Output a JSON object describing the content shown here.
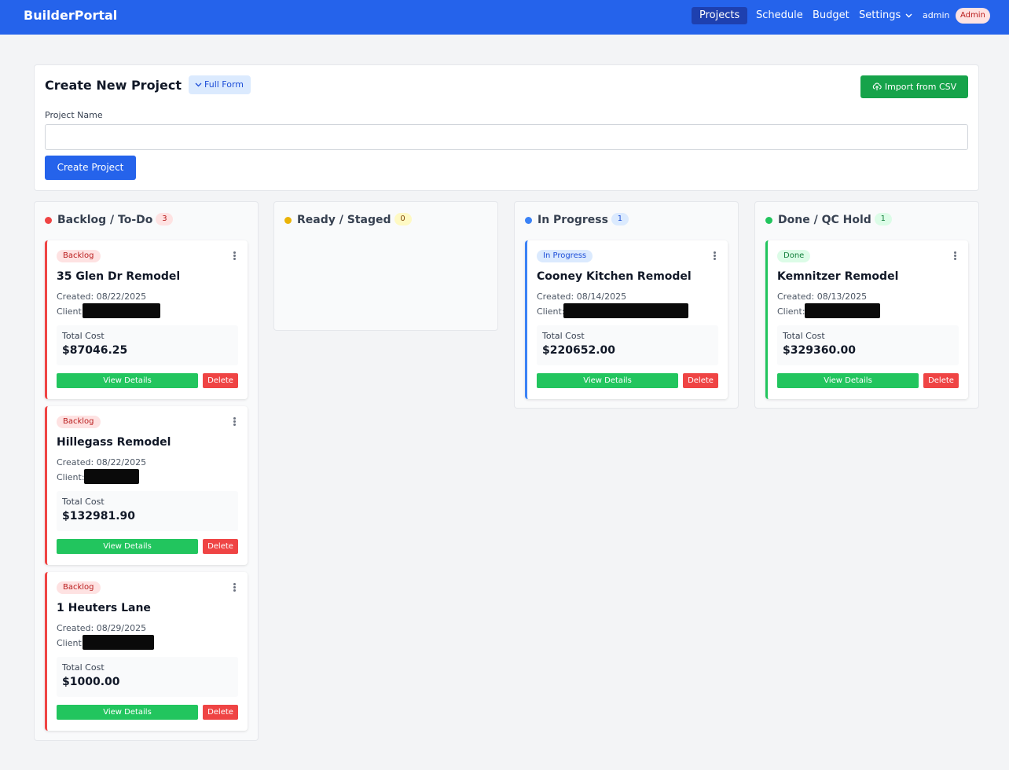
{
  "nav": {
    "brand": "BuilderPortal",
    "items": [
      {
        "label": "Projects",
        "active": true
      },
      {
        "label": "Schedule"
      },
      {
        "label": "Budget"
      },
      {
        "label": "Settings",
        "icon": "chevron-down-icon"
      }
    ],
    "user": "admin",
    "role_badge": "Admin"
  },
  "create_form": {
    "title": "Create New Project",
    "full_form_label": "Full Form",
    "import_label": "Import from CSV",
    "project_name_label": "Project Name",
    "project_name_value": "",
    "create_button_label": "Create Project"
  },
  "columns": [
    {
      "title": "Backlog / To-Do",
      "count": "3",
      "dot_color": "#ef4444",
      "cards": [
        {
          "badge": "Backlog",
          "title": "35 Glen Dr Remodel",
          "created": "Created: 08/22/2025",
          "client_label": "Client:",
          "cost_label": "Total Cost",
          "cost": "$87046.25",
          "view_label": "View Details",
          "delete_label": "Delete"
        },
        {
          "badge": "Backlog",
          "title": "Hillegass Remodel",
          "created": "Created: 08/22/2025",
          "client_label": "Client:",
          "cost_label": "Total Cost",
          "cost": "$132981.90",
          "view_label": "View Details",
          "delete_label": "Delete"
        },
        {
          "badge": "Backlog",
          "title": "1 Heuters Lane",
          "created": "Created: 08/29/2025",
          "client_label": "Client:",
          "cost_label": "Total Cost",
          "cost": "$1000.00",
          "view_label": "View Details",
          "delete_label": "Delete"
        }
      ]
    },
    {
      "title": "Ready / Staged",
      "count": "0",
      "dot_color": "#eab308",
      "cards": []
    },
    {
      "title": "In Progress",
      "count": "1",
      "dot_color": "#3b82f6",
      "cards": [
        {
          "badge": "In Progress",
          "title": "Cooney Kitchen Remodel",
          "created": "Created: 08/14/2025",
          "client_label": "Client:",
          "cost_label": "Total Cost",
          "cost": "$220652.00",
          "view_label": "View Details",
          "delete_label": "Delete"
        }
      ]
    },
    {
      "title": "Done / QC Hold",
      "count": "1",
      "dot_color": "#22c55e",
      "cards": [
        {
          "badge": "Done",
          "title": "Kemnitzer Remodel",
          "created": "Created: 08/13/2025",
          "client_label": "Client:",
          "cost_label": "Total Cost",
          "cost": "$329360.00",
          "view_label": "View Details",
          "delete_label": "Delete"
        }
      ]
    }
  ],
  "colors": {
    "primary": "#2563eb",
    "success": "#22c55e",
    "danger": "#ef4444",
    "warning": "#eab308",
    "info": "#3b82f6"
  }
}
